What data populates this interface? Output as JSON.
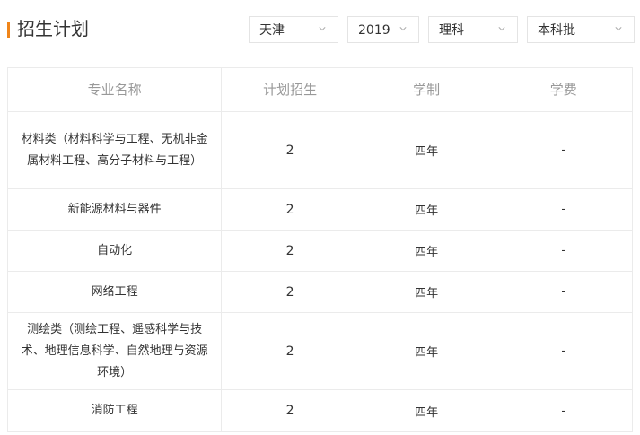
{
  "header": {
    "title": "招生计划"
  },
  "filters": [
    {
      "value": "天津"
    },
    {
      "value": "2019"
    },
    {
      "value": "理科"
    },
    {
      "value": "本科批"
    }
  ],
  "table": {
    "columns": [
      "专业名称",
      "计划招生",
      "学制",
      "学费"
    ],
    "rows": [
      {
        "major": "材料类（材料科学与工程、无机非金属材料工程、高分子材料与工程）",
        "plan": "2",
        "years": "四年",
        "fee": "-"
      },
      {
        "major": "新能源材料与器件",
        "plan": "2",
        "years": "四年",
        "fee": "-"
      },
      {
        "major": "自动化",
        "plan": "2",
        "years": "四年",
        "fee": "-"
      },
      {
        "major": "网络工程",
        "plan": "2",
        "years": "四年",
        "fee": "-"
      },
      {
        "major": "测绘类（测绘工程、遥感科学与技术、地理信息科学、自然地理与资源环境）",
        "plan": "2",
        "years": "四年",
        "fee": "-"
      },
      {
        "major": "消防工程",
        "plan": "2",
        "years": "四年",
        "fee": "-"
      }
    ]
  },
  "colors": {
    "accent": "#f08519",
    "border": "#ebebeb",
    "header_text": "#999999"
  }
}
